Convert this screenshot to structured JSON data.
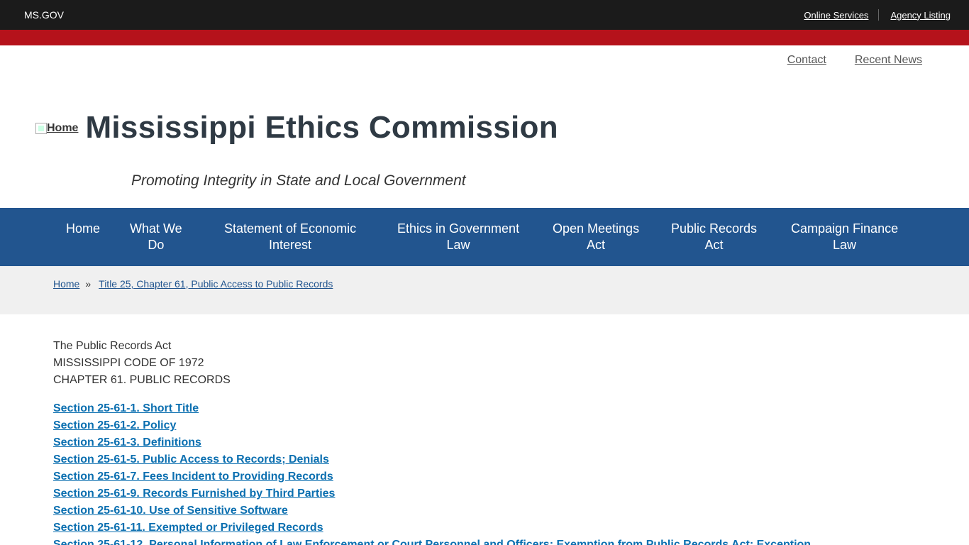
{
  "topbar": {
    "site": "MS.GOV",
    "links": [
      "Online Services",
      "Agency Listing"
    ]
  },
  "utility_links": [
    "Contact",
    "Recent News"
  ],
  "brand": {
    "logo_alt": "Home",
    "title": "Mississippi Ethics Commission",
    "tagline": "Promoting Integrity in State and Local Government"
  },
  "nav": [
    {
      "line1": "Home",
      "line2": ""
    },
    {
      "line1": "What We",
      "line2": "Do"
    },
    {
      "line1": "Statement of Economic",
      "line2": "Interest"
    },
    {
      "line1": "Ethics in Government",
      "line2": "Law"
    },
    {
      "line1": "Open Meetings",
      "line2": "Act"
    },
    {
      "line1": "Public Records",
      "line2": "Act"
    },
    {
      "line1": "Campaign Finance",
      "line2": "Law"
    }
  ],
  "breadcrumb": {
    "home": "Home",
    "separator": "»",
    "current": "Title 25, Chapter 61, Public Access to Public Records"
  },
  "content": {
    "intro": [
      "The Public Records Act",
      "MISSISSIPPI CODE OF 1972",
      "CHAPTER 61. PUBLIC RECORDS"
    ],
    "sections": [
      "Section 25-61-1. Short Title",
      "Section 25-61-2. Policy",
      "Section 25-61-3. Definitions",
      "Section 25-61-5. Public Access to Records; Denials",
      "Section 25-61-7. Fees Incident to Providing Records",
      "Section 25-61-9. Records Furnished by Third Parties",
      "Section 25-61-10. Use of Sensitive Software",
      "Section 25-61-11. Exempted or Privileged Records",
      "Section 25-61-12. Personal Information of Law Enforcement or Court Personnel and Officers; Exemption from Public Records Act; Exception"
    ]
  },
  "colors": {
    "topbar": "#1b1b1b",
    "accent_red": "#b5121b",
    "nav_blue": "#22558f",
    "link_blue": "#0b6fb0",
    "breadcrumb_bg": "#f0f0f0"
  }
}
